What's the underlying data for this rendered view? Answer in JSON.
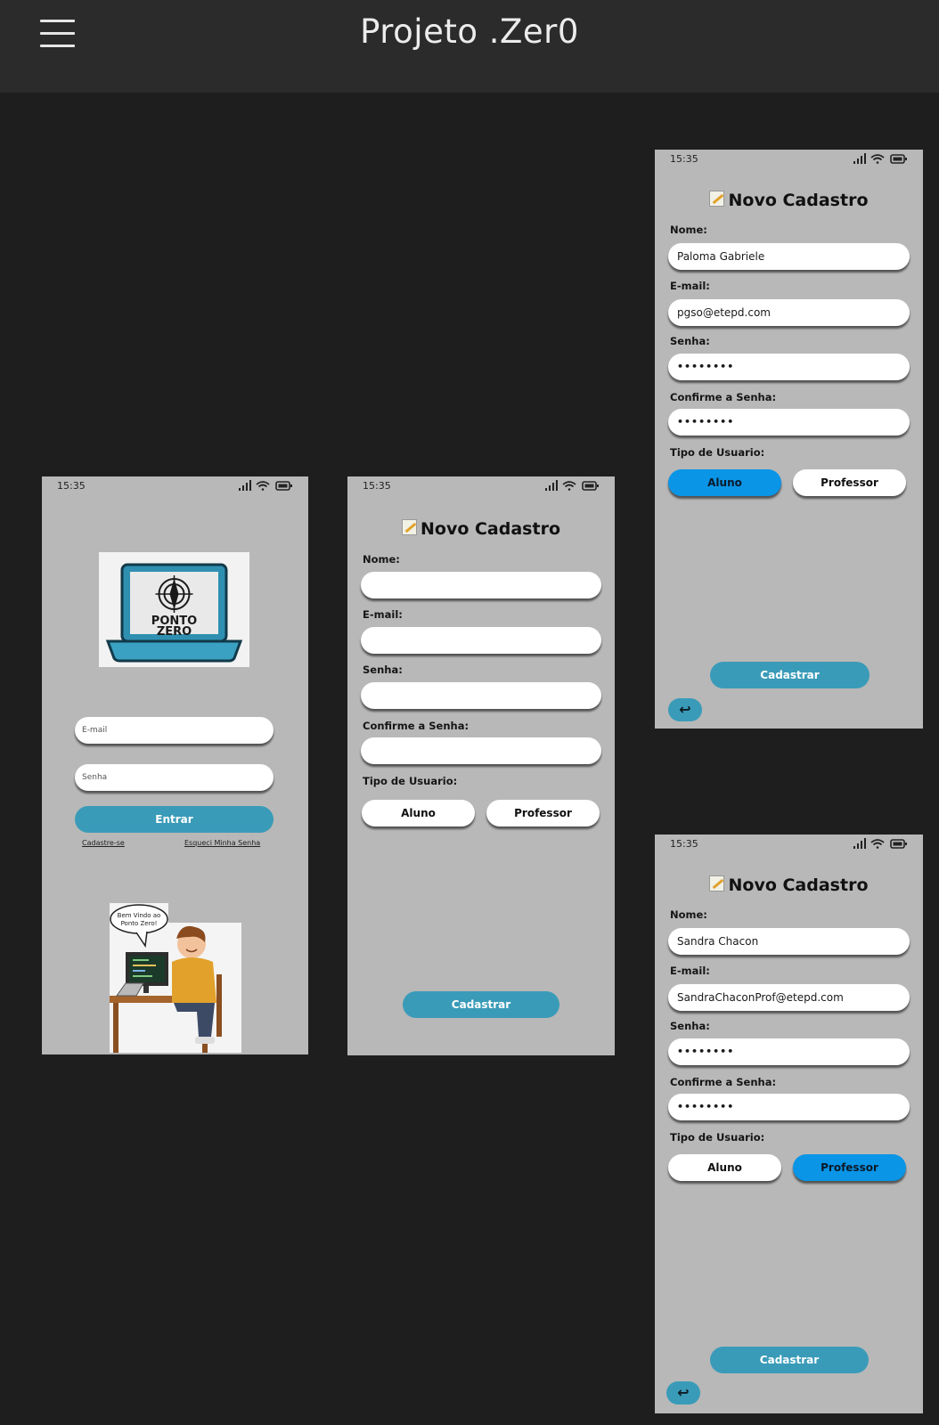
{
  "header": {
    "title": "Projeto .Zer0"
  },
  "status_time": "15:35",
  "login": {
    "logo_text": "PONTO\nZERO",
    "email_placeholder": "E-mail",
    "password_placeholder": "Senha",
    "enter_label": "Entrar",
    "signup_link": "Cadastre-se",
    "forgot_link": "Esqueci Minha Senha",
    "speech_bubble": "Bem Vindo ao Ponto Zero!"
  },
  "register_empty": {
    "title": "Novo Cadastro",
    "name_label": "Nome:",
    "email_label": "E-mail:",
    "password_label": "Senha:",
    "confirm_label": "Confirme a Senha:",
    "type_label": "Tipo de Usuario:",
    "aluno_label": "Aluno",
    "professor_label": "Professor",
    "submit_label": "Cadastrar"
  },
  "register_aluno": {
    "title": "Novo Cadastro",
    "name_label": "Nome:",
    "name_value": "Paloma Gabriele",
    "email_label": "E-mail:",
    "email_value": "pgso@etepd.com",
    "password_label": "Senha:",
    "password_value": "••••••••",
    "confirm_label": "Confirme a Senha:",
    "confirm_value": "••••••••",
    "type_label": "Tipo de Usuario:",
    "aluno_label": "Aluno",
    "professor_label": "Professor",
    "selected_type": "Aluno",
    "submit_label": "Cadastrar",
    "back_label": "↩"
  },
  "register_professor": {
    "title": "Novo Cadastro",
    "name_label": "Nome:",
    "name_value": "Sandra Chacon",
    "email_label": "E-mail:",
    "email_value": "SandraChaconProf@etepd.com",
    "password_label": "Senha:",
    "password_value": "••••••••",
    "confirm_label": "Confirme a Senha:",
    "confirm_value": "••••••••",
    "type_label": "Tipo de Usuario:",
    "aluno_label": "Aluno",
    "professor_label": "Professor",
    "selected_type": "Professor",
    "submit_label": "Cadastrar",
    "back_label": "↩"
  },
  "colors": {
    "background": "#1e1e1e",
    "header": "#2b2b2b",
    "phone": "#b8b8b8",
    "accent_teal": "#3a9bb8",
    "selected_blue": "#0a95e6"
  },
  "icons": [
    "hamburger-menu-icon",
    "signal-icon",
    "wifi-icon",
    "battery-icon",
    "memo-icon",
    "back-arrow-icon"
  ]
}
